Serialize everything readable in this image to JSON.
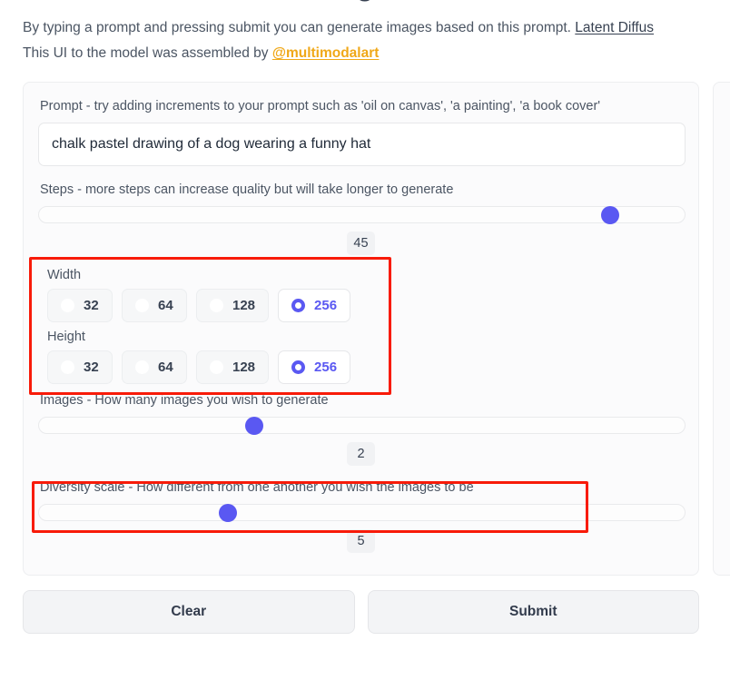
{
  "header": {
    "title_fragment": "g",
    "intro_line1_before": "By typing a prompt and pressing submit you can generate images based on this prompt. ",
    "intro_link1": "Latent Diffus",
    "intro_line2_before": "This UI to the model was assembled by ",
    "intro_link2": "@multimodalart"
  },
  "form": {
    "prompt": {
      "label": "Prompt - try adding increments to your prompt such as 'oil on canvas', 'a painting', 'a book cover'",
      "value": "chalk pastel drawing of a dog wearing a funny hat",
      "placeholder": ""
    },
    "steps": {
      "label": "Steps - more steps can increase quality but will take longer to generate",
      "value": "45",
      "percent": 88.5
    },
    "width": {
      "label": "Width",
      "options": [
        "32",
        "64",
        "128",
        "256"
      ],
      "selected": "256"
    },
    "height": {
      "label": "Height",
      "options": [
        "32",
        "64",
        "128",
        "256"
      ],
      "selected": "256"
    },
    "images": {
      "label": "Images - How many images you wish to generate",
      "value": "2",
      "percent": 33.4
    },
    "diversity": {
      "label": "Diversity scale - How different from one another you wish the images to be",
      "value": "5",
      "percent": 29.2
    }
  },
  "actions": {
    "clear_label": "Clear",
    "submit_label": "Submit"
  },
  "annotations": {
    "highlight_color": "#f81b09",
    "accent_color": "#5a58f2",
    "link_color": "#f0a818"
  }
}
